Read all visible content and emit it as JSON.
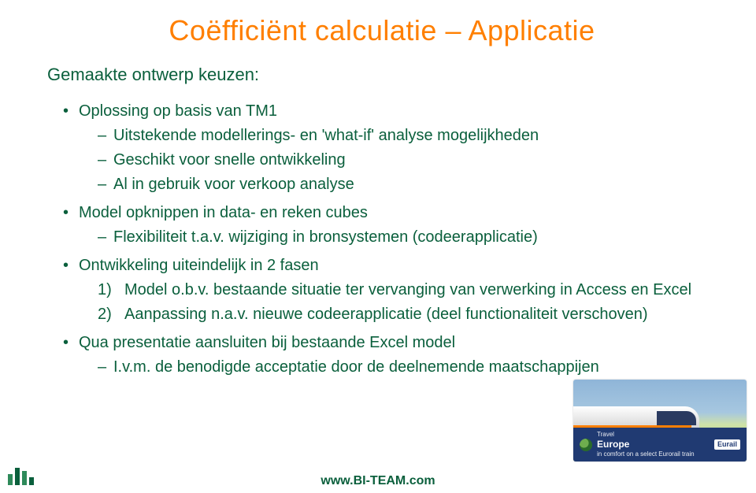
{
  "title": "Coëfficiënt calculatie – Applicatie",
  "subhead": "Gemaakte ontwerp keuzen:",
  "b1": {
    "head": "Oplossing op basis van TM1",
    "s1": "Uitstekende modellerings- en 'what-if' analyse mogelijkheden",
    "s2": "Geschikt voor snelle ontwikkeling",
    "s3": "Al in gebruik voor verkoop analyse"
  },
  "b2": {
    "head": "Model opknippen in data- en reken cubes",
    "s1": "Flexibiliteit t.a.v. wijziging in bronsystemen (codeerapplicatie)"
  },
  "b3": {
    "head": "Ontwikkeling uiteindelijk in 2 fasen",
    "n1": "Model o.b.v. bestaande situatie ter vervanging van verwerking in Access en Excel",
    "n2": "Aanpassing n.a.v. nieuwe codeerapplicatie (deel functionaliteit verschoven)"
  },
  "b4": {
    "head": "Qua presentatie aansluiten bij bestaande Excel model",
    "s1": "I.v.m. de benodigde acceptatie door de deelnemende maatschappijen"
  },
  "promo": {
    "line1": "Travel",
    "line2": "Europe",
    "line3": "in comfort on a select Eurorail train",
    "badge": "Eurail"
  },
  "footerUrl": "www.BI-TEAM.com"
}
